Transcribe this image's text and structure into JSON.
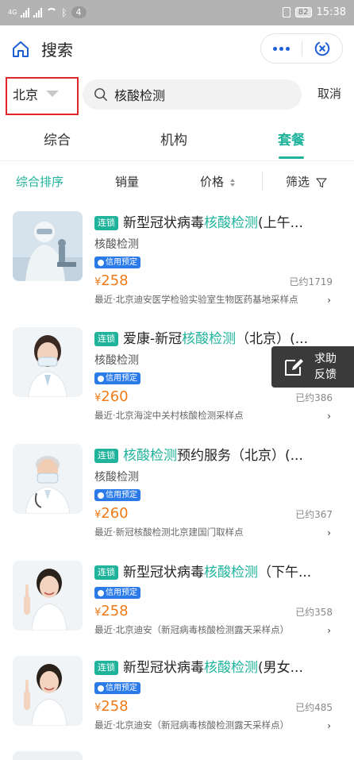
{
  "status_bar": {
    "signal_label": "4G",
    "notification_count": "4",
    "battery": "82",
    "time": "15:38"
  },
  "header": {
    "title": "搜索"
  },
  "search": {
    "city": "北京",
    "query": "核酸检测",
    "cancel": "取消"
  },
  "tabs": [
    {
      "label": "综合"
    },
    {
      "label": "机构"
    },
    {
      "label": "套餐"
    }
  ],
  "sort": {
    "comprehensive": "综合排序",
    "sales": "销量",
    "price": "价格",
    "filter": "筛选"
  },
  "colors": {
    "accent": "#1fb39b",
    "price": "#f07a16",
    "credit": "#2a7be8",
    "highlight_box": "#e0262b"
  },
  "items": [
    {
      "badge": "连锁",
      "title_pre": "新型冠状病毒",
      "title_hl": "核酸检测",
      "title_post": "(上午...",
      "subtitle": "核酸检测",
      "credit": "信用预定",
      "price": "258",
      "sold": "已约1719",
      "location": "最近·北京迪安医学检验实验室生物医药基地采样点",
      "image_icon": "lab-scientist-icon"
    },
    {
      "badge": "连锁",
      "title_pre": "爱康-新冠",
      "title_hl": "核酸检测",
      "title_post": "（北京）(...",
      "subtitle": "核酸检测",
      "credit": "信用预定",
      "price": "260",
      "sold": "已约386",
      "location": "最近·北京海淀中关村核酸检测采样点",
      "image_icon": "female-doctor-mask-icon"
    },
    {
      "badge": "连锁",
      "title_pre": "",
      "title_hl": "核酸检测",
      "title_post": "预约服务（北京）(...",
      "subtitle": "核酸检测",
      "credit": "信用预定",
      "price": "260",
      "sold": "已约367",
      "location": "最近·新冠核酸检测北京建国门取样点",
      "image_icon": "male-doctor-mask-icon"
    },
    {
      "badge": "连锁",
      "title_pre": "新型冠状病毒",
      "title_hl": "核酸检测",
      "title_post": "（下午...",
      "subtitle": "",
      "credit": "信用预定",
      "price": "258",
      "sold": "已约358",
      "location": "最近·北京迪安（新冠病毒核酸检测露天采样点）",
      "image_icon": "female-doctor-pointing-icon"
    },
    {
      "badge": "连锁",
      "title_pre": "新型冠状病毒",
      "title_hl": "核酸检测",
      "title_post": "(男女...",
      "subtitle": "",
      "credit": "信用预定",
      "price": "258",
      "sold": "已约485",
      "location": "最近·北京迪安（新冠病毒核酸检测露天采样点）",
      "image_icon": "female-doctor-pointing-icon"
    }
  ],
  "feedback": {
    "line1": "求助",
    "line2": "反馈"
  }
}
